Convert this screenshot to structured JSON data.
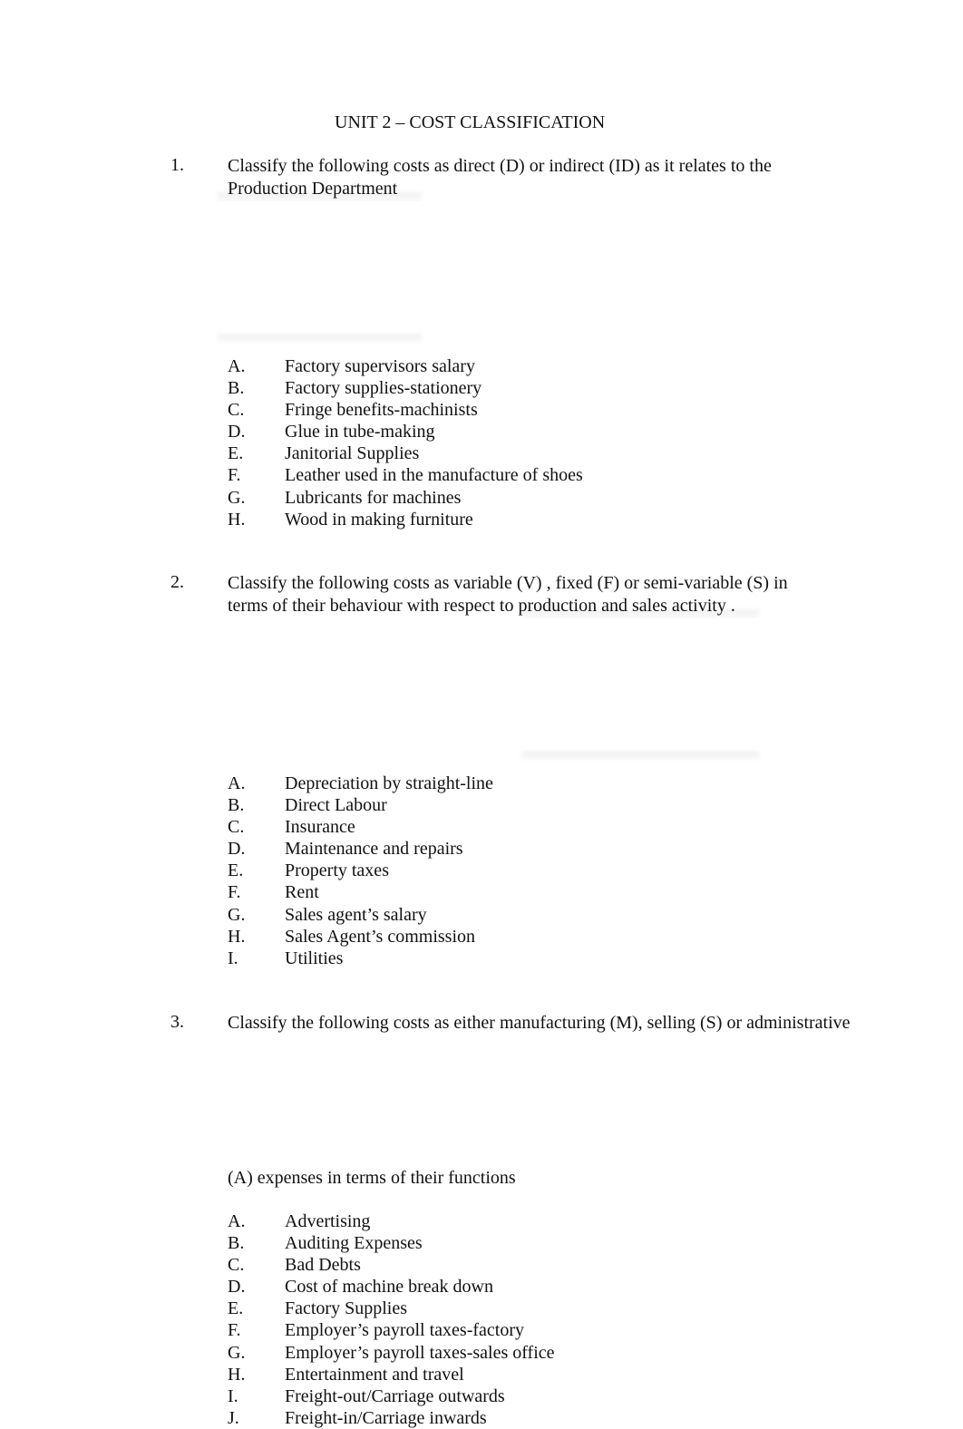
{
  "document": {
    "title": "UNIT 2 – COST CLASSIFICATION",
    "questions": [
      {
        "number": "1.",
        "text_lines": [
          "Classify the following costs as direct (D) or indirect (ID) as it relates to the",
          "Production Department"
        ],
        "items": [
          {
            "letter": "A.",
            "text": "Factory supervisors salary"
          },
          {
            "letter": "B.",
            "text": "Factory supplies-stationery"
          },
          {
            "letter": "C.",
            "text": "Fringe benefits-machinists"
          },
          {
            "letter": "D.",
            "text": "Glue in tube-making"
          },
          {
            "letter": "E.",
            "text": "Janitorial Supplies"
          },
          {
            "letter": "F.",
            "text": "Leather used in the manufacture of shoes"
          },
          {
            "letter": "G.",
            "text": "Lubricants for machines"
          },
          {
            "letter": "H.",
            "text": "Wood in making furniture"
          }
        ]
      },
      {
        "number": "2.",
        "text_lines": [
          "Classify the following costs as variable (V) , fixed (F) or semi-variable (S) in",
          "terms of their behaviour with respect to production and sales activity ."
        ],
        "items": [
          {
            "letter": "A.",
            "text": "Depreciation by straight-line"
          },
          {
            "letter": "B.",
            "text": "Direct Labour"
          },
          {
            "letter": "C.",
            "text": "Insurance"
          },
          {
            "letter": "D.",
            "text": "Maintenance and repairs"
          },
          {
            "letter": "E.",
            "text": "Property taxes"
          },
          {
            "letter": "F.",
            "text": "Rent"
          },
          {
            "letter": "G.",
            "text": "Sales agent’s salary"
          },
          {
            "letter": "H.",
            "text": "Sales Agent’s commission"
          },
          {
            "letter": "I.",
            "text": "Utilities"
          }
        ]
      },
      {
        "number": "3.",
        "text_lines": [
          "Classify the following costs as either manufacturing (M), selling (S) or administrative",
          "(A) expenses in terms of their functions"
        ],
        "items": [
          {
            "letter": "A.",
            "text": "Advertising"
          },
          {
            "letter": "B.",
            "text": "Auditing Expenses"
          },
          {
            "letter": "C.",
            "text": "Bad Debts"
          },
          {
            "letter": "D.",
            "text": "Cost of machine break down"
          },
          {
            "letter": "E.",
            "text": "Factory Supplies"
          },
          {
            "letter": "F.",
            "text": "Employer’s payroll taxes-factory"
          },
          {
            "letter": "G.",
            "text": "Employer’s payroll taxes-sales office"
          },
          {
            "letter": "H.",
            "text": "Entertainment and travel"
          },
          {
            "letter": "I.",
            "text": "Freight-out/Carriage outwards"
          },
          {
            "letter": "J.",
            "text": "Freight-in/Carriage inwards"
          }
        ]
      }
    ]
  }
}
